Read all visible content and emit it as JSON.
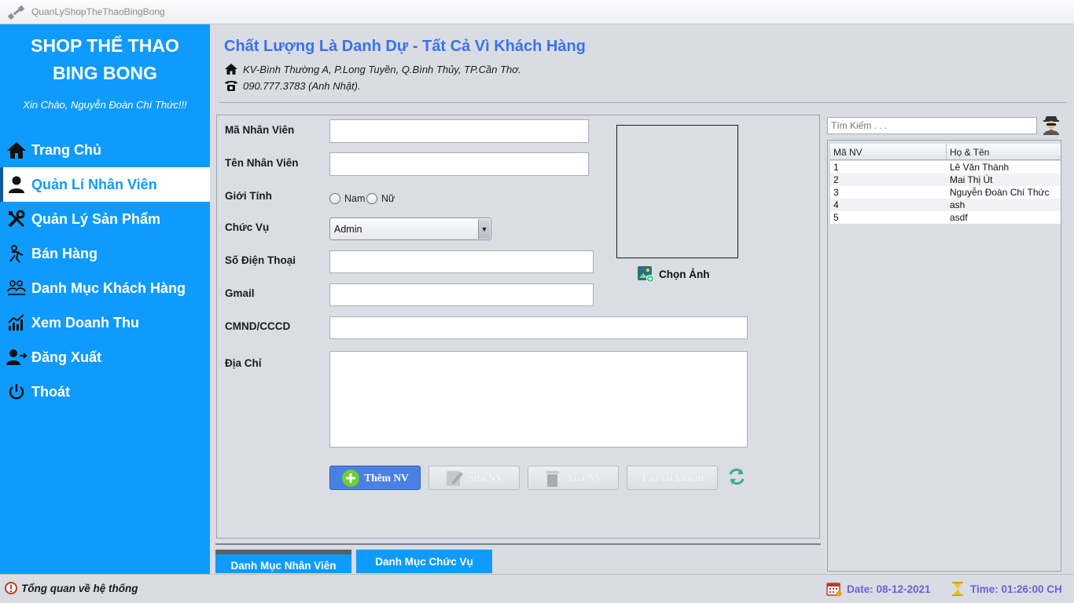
{
  "window": {
    "title": "QuanLyShopTheThaoBingBong"
  },
  "sidebar": {
    "brand_line1": "SHOP THỂ THAO",
    "brand_line2": "BING BONG",
    "greeting": "Xin Chào, Nguyễn Đoàn Chí Thức!!!",
    "items": [
      {
        "label": "Trang Chủ",
        "icon": "home-icon"
      },
      {
        "label": "Quản Lí Nhân Viên",
        "icon": "user-icon",
        "active": true
      },
      {
        "label": "Quản Lý Sản Phẩm",
        "icon": "tools-icon"
      },
      {
        "label": "Bán Hàng",
        "icon": "sales-icon"
      },
      {
        "label": "Danh Mục Khách Hàng",
        "icon": "customers-icon"
      },
      {
        "label": "Xem Doanh Thu",
        "icon": "revenue-chart-icon"
      },
      {
        "label": "Đăng Xuất",
        "icon": "logout-user-icon"
      },
      {
        "label": "Thoát",
        "icon": "power-icon"
      }
    ]
  },
  "header": {
    "slogan": "Chất Lượng Là Danh Dự - Tất Cả Vì Khách Hàng",
    "address": "KV-Bình Thường A, P.Long Tuyền, Q.Bình Thủy, TP.Cần Thơ.",
    "phone": "090.777.3783 (Anh Nhật)."
  },
  "form": {
    "labels": {
      "employee_id": "Mã Nhân Viên",
      "employee_name": "Tên Nhân Viên",
      "gender": "Giới Tính",
      "position": "Chức Vụ",
      "phone": "Số Điện Thoại",
      "gmail": "Gmail",
      "id_card": "CMND/CCCD",
      "address": "Địa Chỉ"
    },
    "values": {
      "employee_id": "",
      "employee_name": "",
      "phone": "",
      "gmail": "",
      "id_card": "",
      "address": ""
    },
    "gender_options": {
      "male": "Nam",
      "female": "Nữ"
    },
    "position_selected": "Admin",
    "choose_photo": "Chọn Ảnh",
    "buttons": {
      "add": "Thêm NV",
      "edit": "Sửa NV",
      "delete": "Xóa NV",
      "create_account": "Tạo tài khoản"
    }
  },
  "tabs": {
    "employees": "Danh Mục Nhân Viên",
    "positions": "Danh Mục Chức Vụ"
  },
  "search": {
    "placeholder": "Tìm Kiếm . . ."
  },
  "table": {
    "columns": [
      "Mã NV",
      "Họ & Tên"
    ],
    "rows": [
      [
        "1",
        "Lê Văn Thành"
      ],
      [
        "2",
        "Mai Thị Út"
      ],
      [
        "3",
        "Nguyễn Đoàn Chí Thức"
      ],
      [
        "4",
        "ash"
      ],
      [
        "5",
        "asdf"
      ]
    ]
  },
  "status": {
    "left": "Tổng quan về hệ thống",
    "date": "Date: 08-12-2021",
    "time": "Time: 01:26:00 CH"
  },
  "colors": {
    "sidebar": "#0f9bfd",
    "accent_text": "#3a72e8",
    "primary_button": "#4a80e3",
    "status_text": "#6a62d8"
  }
}
